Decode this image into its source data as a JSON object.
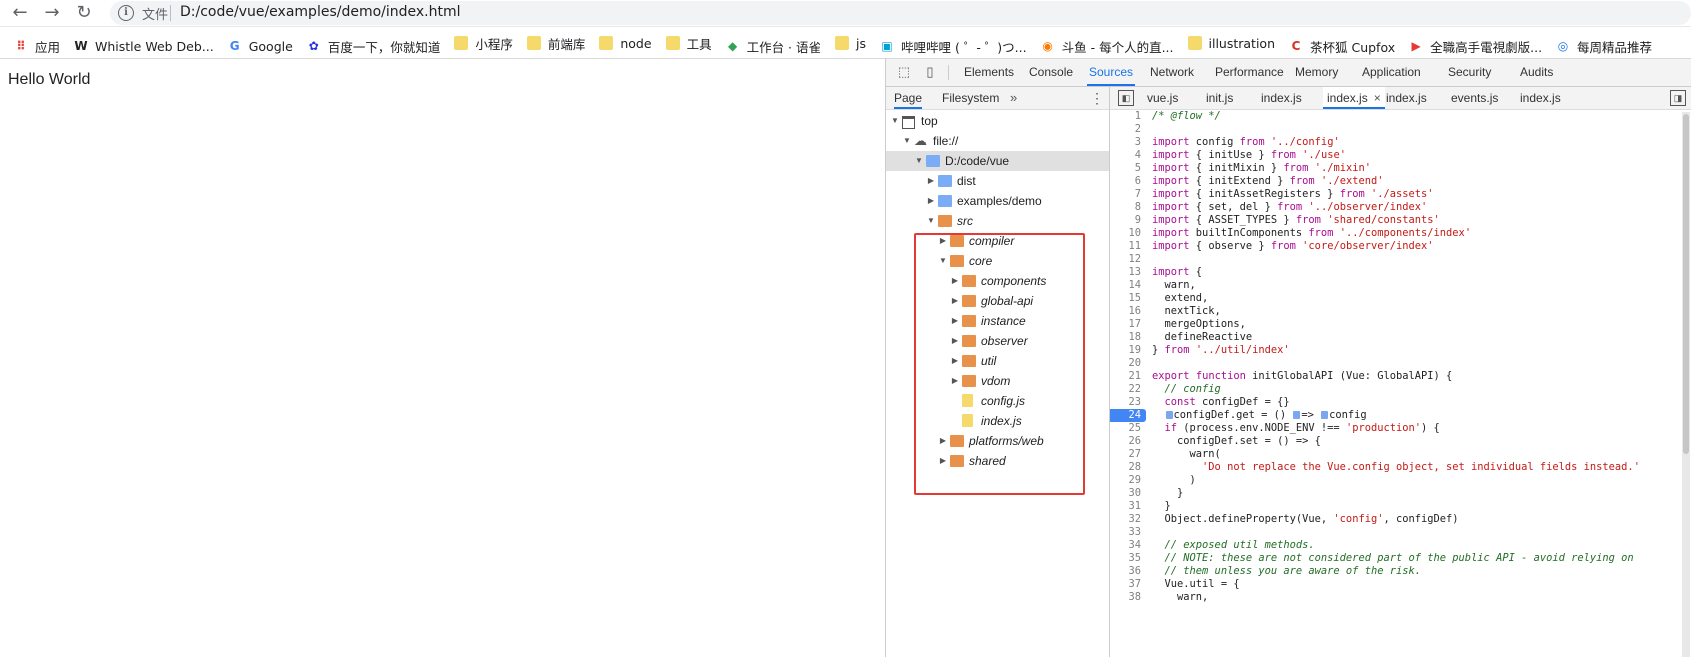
{
  "browser": {
    "url_scheme": "文件",
    "url": "D:/code/vue/examples/demo/index.html",
    "bookmarks": [
      {
        "label": "应用",
        "icon": "apps-grid-icon"
      },
      {
        "label": "Whistle Web Deb...",
        "icon": "whistle-icon"
      },
      {
        "label": "Google",
        "icon": "google-icon"
      },
      {
        "label": "百度一下，你就知道",
        "icon": "baidu-icon"
      },
      {
        "label": "小程序",
        "icon": "folder-icon"
      },
      {
        "label": "前端库",
        "icon": "folder-icon"
      },
      {
        "label": "node",
        "icon": "folder-icon"
      },
      {
        "label": "工具",
        "icon": "folder-icon"
      },
      {
        "label": "工作台 · 语雀",
        "icon": "yuque-icon"
      },
      {
        "label": "js",
        "icon": "folder-icon"
      },
      {
        "label": "哔哩哔哩 ( ゜- ゜)つ...",
        "icon": "bilibili-icon"
      },
      {
        "label": "斗鱼 - 每个人的直...",
        "icon": "douyu-icon"
      },
      {
        "label": "illustration",
        "icon": "folder-icon"
      },
      {
        "label": "茶杯狐 Cupfox",
        "icon": "cupfox-icon"
      },
      {
        "label": "全職高手電視劇版...",
        "icon": "youtube-icon"
      },
      {
        "label": "每周精品推荐",
        "icon": "site-icon"
      }
    ]
  },
  "page": {
    "hello_text": "Hello World"
  },
  "devtools": {
    "tabs": [
      "Elements",
      "Console",
      "Sources",
      "Network",
      "Performance",
      "Memory",
      "Application",
      "Security",
      "Audits"
    ],
    "active_tab": "Sources",
    "nav_tabs": [
      "Page",
      "Filesystem"
    ],
    "nav_more": "»",
    "tree": [
      {
        "label": "top",
        "indent": 0,
        "arrow": "▼",
        "icon": "frame"
      },
      {
        "label": "file://",
        "indent": 1,
        "arrow": "▼",
        "icon": "cloud"
      },
      {
        "label": "D:/code/vue",
        "indent": 2,
        "arrow": "▼",
        "icon": "folder-blue",
        "selected": true
      },
      {
        "label": "dist",
        "indent": 3,
        "arrow": "▶",
        "icon": "folder-blue"
      },
      {
        "label": "examples/demo",
        "indent": 3,
        "arrow": "▶",
        "icon": "folder-blue"
      },
      {
        "label": "src",
        "indent": 3,
        "arrow": "▼",
        "icon": "folder-orange",
        "italic": true
      },
      {
        "label": "compiler",
        "indent": 4,
        "arrow": "▶",
        "icon": "folder-orange",
        "italic": true
      },
      {
        "label": "core",
        "indent": 4,
        "arrow": "▼",
        "icon": "folder-orange",
        "italic": true
      },
      {
        "label": "components",
        "indent": 5,
        "arrow": "▶",
        "icon": "folder-orange",
        "italic": true
      },
      {
        "label": "global-api",
        "indent": 5,
        "arrow": "▶",
        "icon": "folder-orange",
        "italic": true
      },
      {
        "label": "instance",
        "indent": 5,
        "arrow": "▶",
        "icon": "folder-orange",
        "italic": true
      },
      {
        "label": "observer",
        "indent": 5,
        "arrow": "▶",
        "icon": "folder-orange",
        "italic": true
      },
      {
        "label": "util",
        "indent": 5,
        "arrow": "▶",
        "icon": "folder-orange",
        "italic": true
      },
      {
        "label": "vdom",
        "indent": 5,
        "arrow": "▶",
        "icon": "folder-orange",
        "italic": true
      },
      {
        "label": "config.js",
        "indent": 5,
        "arrow": "",
        "icon": "file",
        "italic": true
      },
      {
        "label": "index.js",
        "indent": 5,
        "arrow": "",
        "icon": "file",
        "italic": true
      },
      {
        "label": "platforms/web",
        "indent": 4,
        "arrow": "▶",
        "icon": "folder-orange",
        "italic": true
      },
      {
        "label": "shared",
        "indent": 4,
        "arrow": "▶",
        "icon": "folder-orange",
        "italic": true
      }
    ],
    "editor_tabs": [
      "vue.js",
      "init.js",
      "index.js",
      "index.js",
      "index.js",
      "events.js",
      "index.js"
    ],
    "active_editor_tab_index": 3,
    "breakpoint_line": 24,
    "code_lines": [
      [
        {
          "t": "/* @flow */",
          "c": "cmt"
        }
      ],
      [],
      [
        {
          "t": "import",
          "c": "kw"
        },
        {
          "t": " config "
        },
        {
          "t": "from",
          "c": "kw"
        },
        {
          "t": " "
        },
        {
          "t": "'../config'",
          "c": "str"
        }
      ],
      [
        {
          "t": "import",
          "c": "kw"
        },
        {
          "t": " { initUse } "
        },
        {
          "t": "from",
          "c": "kw"
        },
        {
          "t": " "
        },
        {
          "t": "'./use'",
          "c": "str"
        }
      ],
      [
        {
          "t": "import",
          "c": "kw"
        },
        {
          "t": " { initMixin } "
        },
        {
          "t": "from",
          "c": "kw"
        },
        {
          "t": " "
        },
        {
          "t": "'./mixin'",
          "c": "str"
        }
      ],
      [
        {
          "t": "import",
          "c": "kw"
        },
        {
          "t": " { initExtend } "
        },
        {
          "t": "from",
          "c": "kw"
        },
        {
          "t": " "
        },
        {
          "t": "'./extend'",
          "c": "str"
        }
      ],
      [
        {
          "t": "import",
          "c": "kw"
        },
        {
          "t": " { initAssetRegisters } "
        },
        {
          "t": "from",
          "c": "kw"
        },
        {
          "t": " "
        },
        {
          "t": "'./assets'",
          "c": "str"
        }
      ],
      [
        {
          "t": "import",
          "c": "kw"
        },
        {
          "t": " { set, del } "
        },
        {
          "t": "from",
          "c": "kw"
        },
        {
          "t": " "
        },
        {
          "t": "'../observer/index'",
          "c": "str"
        }
      ],
      [
        {
          "t": "import",
          "c": "kw"
        },
        {
          "t": " { ASSET_TYPES } "
        },
        {
          "t": "from",
          "c": "kw"
        },
        {
          "t": " "
        },
        {
          "t": "'shared/constants'",
          "c": "str"
        }
      ],
      [
        {
          "t": "import",
          "c": "kw"
        },
        {
          "t": " builtInComponents "
        },
        {
          "t": "from",
          "c": "kw"
        },
        {
          "t": " "
        },
        {
          "t": "'../components/index'",
          "c": "str"
        }
      ],
      [
        {
          "t": "import",
          "c": "kw"
        },
        {
          "t": " { observe } "
        },
        {
          "t": "from",
          "c": "kw"
        },
        {
          "t": " "
        },
        {
          "t": "'core/observer/index'",
          "c": "str"
        }
      ],
      [],
      [
        {
          "t": "import",
          "c": "kw"
        },
        {
          "t": " {"
        }
      ],
      [
        {
          "t": "  warn,"
        }
      ],
      [
        {
          "t": "  extend,"
        }
      ],
      [
        {
          "t": "  nextTick,"
        }
      ],
      [
        {
          "t": "  mergeOptions,"
        }
      ],
      [
        {
          "t": "  defineReactive"
        }
      ],
      [
        {
          "t": "} "
        },
        {
          "t": "from",
          "c": "kw"
        },
        {
          "t": " "
        },
        {
          "t": "'../util/index'",
          "c": "str"
        }
      ],
      [],
      [
        {
          "t": "export",
          "c": "kw"
        },
        {
          "t": " "
        },
        {
          "t": "function",
          "c": "kw"
        },
        {
          "t": " initGlobalAPI (Vue: GlobalAPI) {"
        }
      ],
      [
        {
          "t": "  "
        },
        {
          "t": "// config",
          "c": "cmt"
        }
      ],
      [
        {
          "t": "  "
        },
        {
          "t": "const",
          "c": "kw"
        },
        {
          "t": " configDef = {}"
        }
      ],
      [
        {
          "t": "  "
        },
        {
          "t": "",
          "c": "bpm"
        },
        {
          "t": "configDef.get = () "
        },
        {
          "t": "",
          "c": "bpm"
        },
        {
          "t": "=> "
        },
        {
          "t": "",
          "c": "bpm"
        },
        {
          "t": "config"
        }
      ],
      [
        {
          "t": "  "
        },
        {
          "t": "if",
          "c": "kw"
        },
        {
          "t": " (process.env.NODE_ENV !== "
        },
        {
          "t": "'production'",
          "c": "str"
        },
        {
          "t": ") {"
        }
      ],
      [
        {
          "t": "    configDef.set = () => {"
        }
      ],
      [
        {
          "t": "      warn("
        }
      ],
      [
        {
          "t": "        "
        },
        {
          "t": "'Do not replace the Vue.config object, set individual fields instead.'",
          "c": "str"
        }
      ],
      [
        {
          "t": "      )"
        }
      ],
      [
        {
          "t": "    }"
        }
      ],
      [
        {
          "t": "  }"
        }
      ],
      [
        {
          "t": "  Object.defineProperty(Vue, "
        },
        {
          "t": "'config'",
          "c": "str"
        },
        {
          "t": ", configDef)"
        }
      ],
      [],
      [
        {
          "t": "  "
        },
        {
          "t": "// exposed util methods.",
          "c": "cmt"
        }
      ],
      [
        {
          "t": "  "
        },
        {
          "t": "// NOTE: these are not considered part of the public API - avoid relying on",
          "c": "cmt"
        }
      ],
      [
        {
          "t": "  "
        },
        {
          "t": "// them unless you are aware of the risk.",
          "c": "cmt"
        }
      ],
      [
        {
          "t": "  Vue.util = {"
        }
      ],
      [
        {
          "t": "    warn,"
        }
      ]
    ]
  }
}
